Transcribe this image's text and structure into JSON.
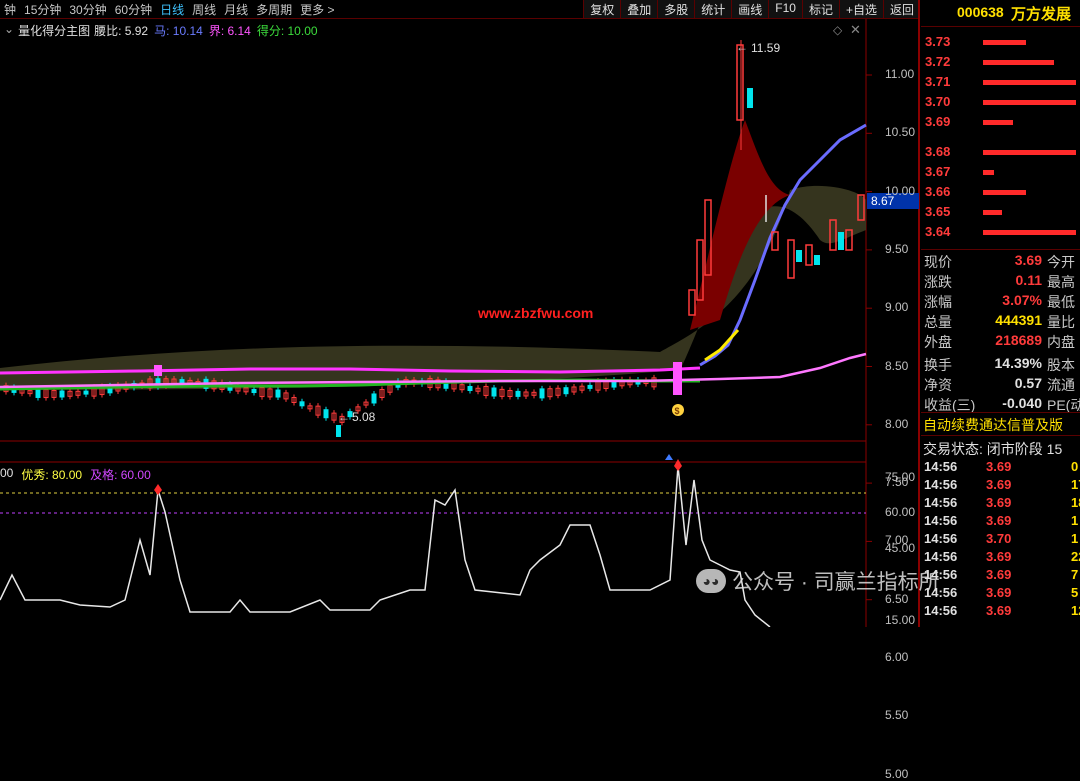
{
  "toolbar": {
    "periods": [
      "钟",
      "15分钟",
      "30分钟",
      "60分钟",
      "日线",
      "周线",
      "月线",
      "多周期",
      "更多 >"
    ],
    "active_period": "日线",
    "tools": [
      "复权",
      "叠加",
      "多股",
      "统计",
      "画线",
      "F10",
      "标记",
      "+自选",
      "返回"
    ]
  },
  "indicator": {
    "name": "量化得分主图",
    "items": [
      {
        "label": "腰比: 5.92",
        "color": "#e0e0e0"
      },
      {
        "label": "马: 10.14",
        "color": "#6a7bff"
      },
      {
        "label": "界: 6.14",
        "color": "#ff55ff"
      },
      {
        "label": "得分: 10.00",
        "color": "#3cdc3c"
      }
    ]
  },
  "watermark_site": "www.zbzfwu.com",
  "price_axis": [
    "11.00",
    "10.50",
    "10.00",
    "9.50",
    "9.00",
    "8.50",
    "8.00",
    "7.50",
    "7.00",
    "6.50",
    "6.00",
    "5.50",
    "5.00"
  ],
  "current_price_tag": "8.67",
  "high_label": "11.59",
  "low_label": "5.08",
  "sub_indicator": {
    "prefix": "00",
    "items": [
      {
        "label": "优秀: 80.00",
        "color": "#ffff44"
      },
      {
        "label": "及格: 60.00",
        "color": "#d048ff"
      }
    ],
    "axis": [
      "75.00",
      "60.00",
      "45.00",
      "15.00"
    ]
  },
  "stock": {
    "code": "000638",
    "name": "万方发展"
  },
  "order_book": [
    {
      "price": "3.73",
      "bar": 0.45
    },
    {
      "price": "3.72",
      "bar": 0.75
    },
    {
      "price": "3.71",
      "bar": 0.98
    },
    {
      "price": "3.70",
      "bar": 0.98
    },
    {
      "price": "3.69",
      "bar": 0.32
    },
    {
      "price": "3.68",
      "bar": 0.98
    },
    {
      "price": "3.67",
      "bar": 0.12
    },
    {
      "price": "3.66",
      "bar": 0.45
    },
    {
      "price": "3.65",
      "bar": 0.2
    },
    {
      "price": "3.64",
      "bar": 0.98
    }
  ],
  "quote": [
    {
      "k": "现价",
      "v": "3.69",
      "c": "#ff3b3b",
      "k2": "今开"
    },
    {
      "k": "涨跌",
      "v": "0.11",
      "c": "#ff3b3b",
      "k2": "最高"
    },
    {
      "k": "涨幅",
      "v": "3.07%",
      "c": "#ff3b3b",
      "k2": "最低"
    },
    {
      "k": "总量",
      "v": "444391",
      "c": "#ffe000",
      "k2": "量比"
    },
    {
      "k": "外盘",
      "v": "218689",
      "c": "#ff3b3b",
      "k2": "内盘"
    },
    {
      "k": "换手",
      "v": "14.39%",
      "c": "#e0e0e0",
      "k2": "股本"
    },
    {
      "k": "净资",
      "v": "0.57",
      "c": "#e0e0e0",
      "k2": "流通"
    },
    {
      "k": "收益(三)",
      "v": "-0.040",
      "c": "#e0e0e0",
      "k2": "PE(动"
    }
  ],
  "banner": "自动续费通达信普及版",
  "trade_status": "交易状态: 闭市阶段 15",
  "ticks": [
    {
      "t": "14:56",
      "p": "3.69",
      "v": "0"
    },
    {
      "t": "14:56",
      "p": "3.69",
      "v": "17"
    },
    {
      "t": "14:56",
      "p": "3.69",
      "v": "18"
    },
    {
      "t": "14:56",
      "p": "3.69",
      "v": "1"
    },
    {
      "t": "14:56",
      "p": "3.70",
      "v": "1"
    },
    {
      "t": "14:56",
      "p": "3.69",
      "v": "22"
    },
    {
      "t": "14:56",
      "p": "3.69",
      "v": "7"
    },
    {
      "t": "14:56",
      "p": "3.69",
      "v": "5"
    },
    {
      "t": "14:56",
      "p": "3.69",
      "v": "12"
    }
  ],
  "watermark_wechat": "公众号 · 司赢兰指标所"
}
